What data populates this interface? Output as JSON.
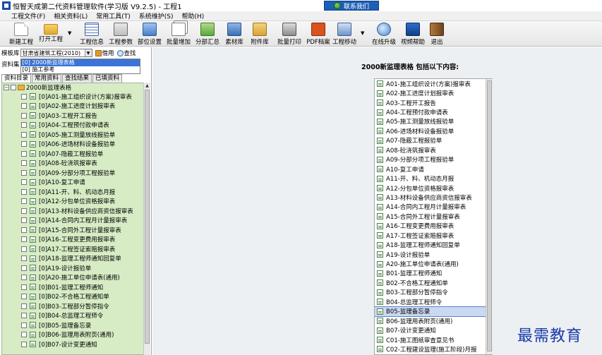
{
  "window": {
    "title": "恒智天成第二代资料管理软件(学习版 V9.2.5) - 工程1",
    "contact_button": "联系我们"
  },
  "menu": [
    "工程文件(F)",
    "相关资料(L)",
    "常用工具(T)",
    "系统维护(S)",
    "帮助(H)"
  ],
  "toolbar": {
    "new_project": "新建工程",
    "open_project": "打开工程",
    "project_info": "工程信息",
    "project_params": "工程参数",
    "section_settings": "部位设置",
    "batch_add": "批量增加",
    "section_summary": "分部汇总",
    "material_lib": "素材库",
    "attachment_lib": "附件库",
    "batch_print": "批量打印",
    "pdf_archive": "PDF档案",
    "project_move": "工程移动",
    "online_upgrade": "在线升级",
    "video_help": "视频帮助",
    "exit": "退出"
  },
  "left": {
    "template_label": "模板库",
    "template_value": "甘肃省建筑工程(2010)",
    "borrow_button": "借用",
    "search_button": "查找",
    "dataset_label": "资料集",
    "dataset_items": [
      "[0] 2000新监理表格",
      "[0] 施工参考"
    ],
    "tabs": [
      "资料目录",
      "常用资料",
      "查找结果",
      "已填资料"
    ],
    "tree_root": "2000新监理表格",
    "tree_items": [
      "[0]A01-施工组织设计(方案)报审表",
      "[0]A02-施工进度计划报审表",
      "[0]A03-工程开工报告",
      "[0]A04-工程预付款申请表",
      "[0]A05-施工测量放线报验单",
      "[0]A06-进场材料设备报验单",
      "[0]A07-隐蔽工程报验单",
      "[0]A08-砼浇筑报审表",
      "[0]A09-分部分项工程报验单",
      "[0]A10-复工申请",
      "[0]A11-开、料、机动态月报",
      "[0]A12-分包单位资格报审表",
      "[0]A13-材料设备供应商资信报审表",
      "[0]A14-合同内工程月计量报审表",
      "[0]A15-合同外工程计量报审表",
      "[0]A16-工程变更费用报审表",
      "[0]A17-工程签证索赔报审表",
      "[0]A18-监理工程师通知回复单",
      "[0]A19-设计报验单",
      "[0]A20-施工单位申请表(通用)",
      "[0]B01-监理工程师通知",
      "[0]B02-不合格工程通知单",
      "[0]B03-工程部分暂停指令",
      "[0]B04-总监理工程师令",
      "[0]B05-监理备忘录",
      "[0]B06-监理用表附页(通用)",
      "[0]B07-设计变更通知"
    ]
  },
  "right": {
    "heading": "2000新监理表格 包括以下内容:",
    "items": [
      "A01-施工组织设计(方案)报审表",
      "A02-施工进度计划报审表",
      "A03-工程开工报告",
      "A04-工程预付款申请表",
      "A05-施工测量放线报验单",
      "A06-进场材料设备报验单",
      "A07-隐蔽工程报验单",
      "A08-砼浇筑报审表",
      "A09-分部分项工程报验单",
      "A10-复工申请",
      "A11-开、料、机动态月报",
      "A12-分包单位资格报审表",
      "A13-材料设备供应商资信报审表",
      "A14-合同内工程月计量报审表",
      "A15-合同外工程计量报审表",
      "A16-工程变更费用报审表",
      "A17-工程签证索赔报审表",
      "A18-监理工程师通知回复单",
      "A19-设计报验单",
      "A20-施工单位申请表(通用)",
      "B01-监理工程师通知",
      "B02-不合格工程通知单",
      "B03-工程部分暂停指令",
      "B04-总监理工程师令",
      "B05-监理备忘录",
      "B06-监理用表附页(通用)",
      "B07-设计变更通知",
      "C01-施工图纸审查意见书",
      "C02-工程建设监理(施工阶段)月报"
    ],
    "selected_index": 24
  },
  "watermark": "最需教育"
}
